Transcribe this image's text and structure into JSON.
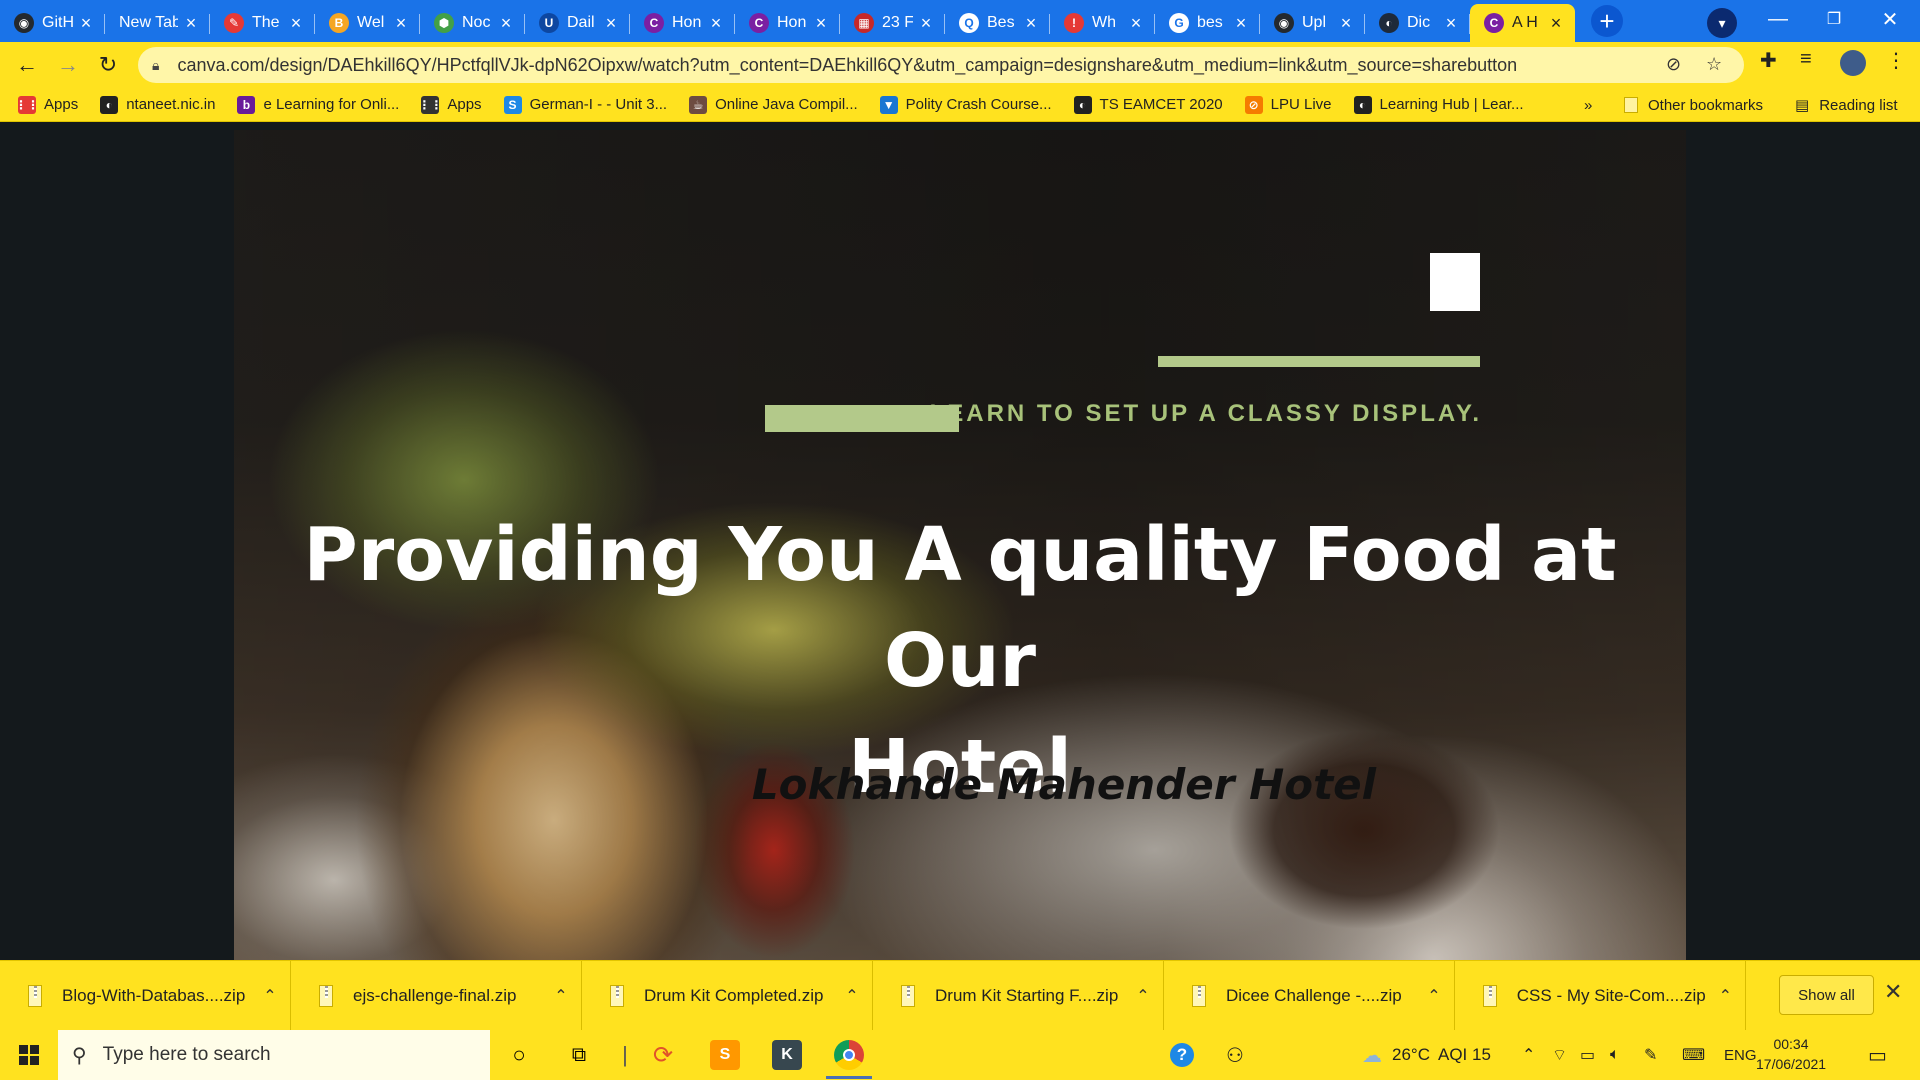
{
  "browser": {
    "tabs": [
      {
        "title": "GitHub",
        "fav_color": "#24292e",
        "fav_glyph": "◉"
      },
      {
        "title": "New Tab",
        "fav_color": "",
        "fav_glyph": ""
      },
      {
        "title": "The",
        "fav_color": "#e53935",
        "fav_glyph": "✎"
      },
      {
        "title": "Wel",
        "fav_color": "#f5a623",
        "fav_glyph": "B"
      },
      {
        "title": "Noc",
        "fav_color": "#43a047",
        "fav_glyph": "⬢"
      },
      {
        "title": "Dail",
        "fav_color": "#0d47a1",
        "fav_glyph": "U"
      },
      {
        "title": "Hon",
        "fav_color": "#7b1fa2",
        "fav_glyph": "C"
      },
      {
        "title": "Hon",
        "fav_color": "#7b1fa2",
        "fav_glyph": "C"
      },
      {
        "title": "23 F",
        "fav_color": "#c62828",
        "fav_glyph": "▦"
      },
      {
        "title": "Bes",
        "fav_color": "#ffffff",
        "fav_glyph": "Q"
      },
      {
        "title": "Wh",
        "fav_color": "#e53935",
        "fav_glyph": "!"
      },
      {
        "title": "bes",
        "fav_color": "#ffffff",
        "fav_glyph": "G"
      },
      {
        "title": "Upl",
        "fav_color": "#24292e",
        "fav_glyph": "◉"
      },
      {
        "title": "Dic",
        "fav_color": "#1e2a3a",
        "fav_glyph": "◐"
      },
      {
        "title": "A H",
        "fav_color": "#7b1fa2",
        "fav_glyph": "C",
        "active": true
      }
    ],
    "new_tab_label": "+",
    "url": "canva.com/design/DAEhkill6QY/HPctfqllVJk-dpN62Oipxw/watch?utm_content=DAEhkill6QY&utm_campaign=designshare&utm_medium=link&utm_source=sharebutton",
    "bookmarks": [
      {
        "label": "Apps",
        "icon_color": "#e53935",
        "glyph": "⋮⋮"
      },
      {
        "label": "ntaneet.nic.in",
        "icon_color": "#222222",
        "glyph": "◐"
      },
      {
        "label": "e Learning for Onli...",
        "icon_color": "#6a1b9a",
        "glyph": "b"
      },
      {
        "label": "Apps",
        "icon_color": "#333333",
        "glyph": "⋮⋮"
      },
      {
        "label": "German-I - - Unit 3...",
        "icon_color": "#1e88e5",
        "glyph": "S"
      },
      {
        "label": "Online Java Compil...",
        "icon_color": "#6d4c41",
        "glyph": "☕"
      },
      {
        "label": "Polity Crash Course...",
        "icon_color": "#1976d2",
        "glyph": "▼"
      },
      {
        "label": "TS EAMCET 2020",
        "icon_color": "#222222",
        "glyph": "◐"
      },
      {
        "label": "LPU Live",
        "icon_color": "#f57c00",
        "glyph": "⊘"
      },
      {
        "label": "Learning Hub | Lear...",
        "icon_color": "#222222",
        "glyph": "◐"
      }
    ],
    "bookmarks_more": "»",
    "other_bookmarks": "Other bookmarks",
    "reading_list": "Reading list"
  },
  "slide": {
    "tagline": "LEARN TO SET UP A CLASSY DISPLAY.",
    "headline_line1": "Providing You A quality Food at Our",
    "headline_line2": "Hotel",
    "subheadline": "Lokhande Mahender Hotel",
    "accent_color": "#b3c98a"
  },
  "downloads": {
    "items": [
      {
        "name": "Blog-With-Databas....zip"
      },
      {
        "name": "ejs-challenge-final.zip"
      },
      {
        "name": "Drum Kit Completed.zip"
      },
      {
        "name": "Drum Kit Starting F....zip"
      },
      {
        "name": "Dicee Challenge -....zip"
      },
      {
        "name": "CSS - My Site-Com....zip"
      }
    ],
    "show_all": "Show all"
  },
  "taskbar": {
    "search_placeholder": "Type here to search",
    "weather": "26°C",
    "aqi": "AQI 15",
    "language": "ENG",
    "time": "00:34",
    "date": "17/06/2021"
  }
}
